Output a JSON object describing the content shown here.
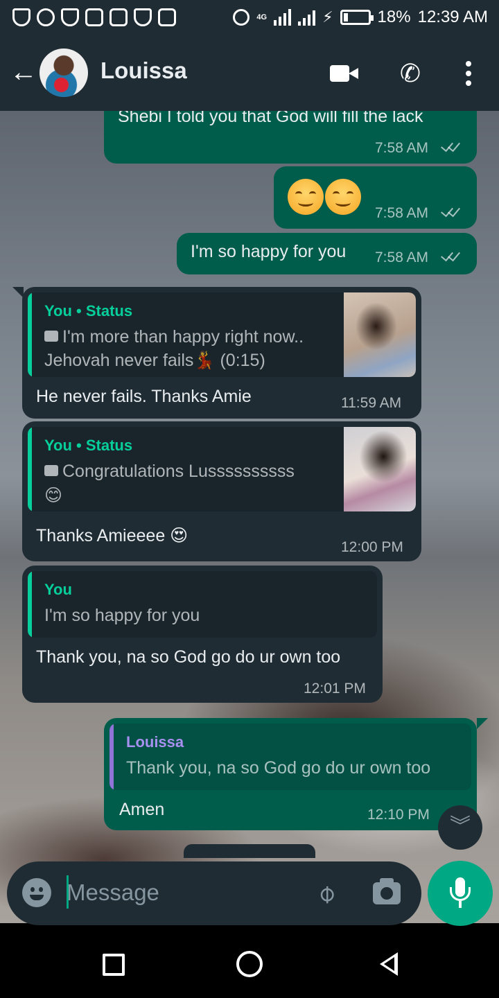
{
  "status_bar": {
    "battery_percent": "18%",
    "time": "12:39 AM",
    "network": "4G"
  },
  "header": {
    "contact_name": "Louissa"
  },
  "messages": [
    {
      "direction": "out",
      "text": "Shebi I told you that God will fill the lack",
      "time": "7:58 AM"
    },
    {
      "direction": "out",
      "text": "😊😊",
      "time": "7:58 AM"
    },
    {
      "direction": "out",
      "text": "I'm so happy for you",
      "time": "7:58 AM"
    },
    {
      "direction": "in",
      "quote": {
        "author": "You • Status",
        "line1": "I'm more than happy right now..",
        "line2": "Jehovah never fails💃 (0:15)"
      },
      "text": "He never fails. Thanks Amie",
      "time": "11:59 AM"
    },
    {
      "direction": "in",
      "quote": {
        "author": "You • Status",
        "line1": "Congratulations Lussssssssss",
        "line2": "😊"
      },
      "text": "Thanks Amieeee 😍",
      "time": "12:00 PM"
    },
    {
      "direction": "in",
      "quote": {
        "author": "You",
        "line1": "I'm so happy for you"
      },
      "text": "Thank you, na so God go do ur own too",
      "time": "12:01 PM"
    },
    {
      "direction": "out",
      "quote": {
        "author": "Louissa",
        "line1": "Thank you, na so God go do ur own too"
      },
      "text": "Amen",
      "time": "12:10 PM"
    }
  ],
  "composer": {
    "placeholder": "Message"
  },
  "colors": {
    "outgoing_bubble": "#005c4b",
    "incoming_bubble": "#1f2c34",
    "accent": "#00a884",
    "quote_author": "#06cf9c",
    "quote_author_alt": "#a890f0"
  },
  "icons": {
    "back": "arrow-left-icon",
    "video": "video-camera-icon",
    "call": "phone-icon",
    "menu": "more-vert-icon",
    "emoji": "emoji-icon",
    "attach": "paperclip-icon",
    "camera": "camera-icon",
    "mic": "microphone-icon",
    "scroll_down": "double-chevron-down-icon"
  }
}
